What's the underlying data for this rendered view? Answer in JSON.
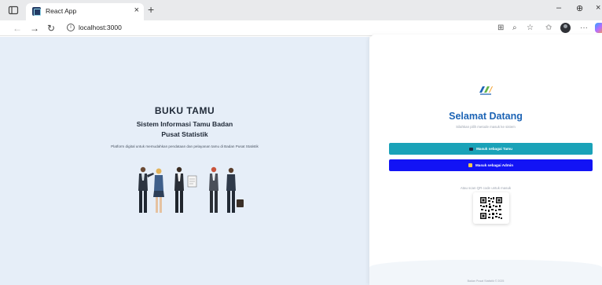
{
  "browser": {
    "tab_title": "React App",
    "tab_close": "×",
    "new_tab": "+",
    "url": "localhost:3000",
    "icons": {
      "back": "arrow-left",
      "forward": "arrow-right",
      "refresh": "refresh",
      "info": "info",
      "tab_actions": "tab-actions",
      "zoom": "zoom",
      "favorite": "star",
      "favorites": "favorites",
      "profile": "profile",
      "more": "ellipsis",
      "copilot": "copilot"
    },
    "window": {
      "minimize": "–",
      "pin": "⊕",
      "close": "×"
    }
  },
  "hero": {
    "title": "BUKU TAMU",
    "subtitle_line1": "Sistem Informasi Tamu Badan",
    "subtitle_line2": "Pusat Statistik",
    "description": "Platform digital untuk memudahkan pendataan dan pelayanan tamu di Badan Pusat Statistik"
  },
  "login": {
    "welcome": "Selamat Datang",
    "subtitle": "Silahkan pilih metode masuk ke sistem",
    "guest_button": "Masuk sebagai Tamu",
    "admin_button": "Masuk sebagai Admin",
    "qr_hint": "Atau scan QR code untuk masuk",
    "footer": "Badan Pusat Statistik © 2025"
  },
  "colors": {
    "hero_background": "#e6eef8",
    "brand_blue": "#1d64b5",
    "guest_button": "#1aa2b8",
    "admin_button": "#1213f5"
  }
}
